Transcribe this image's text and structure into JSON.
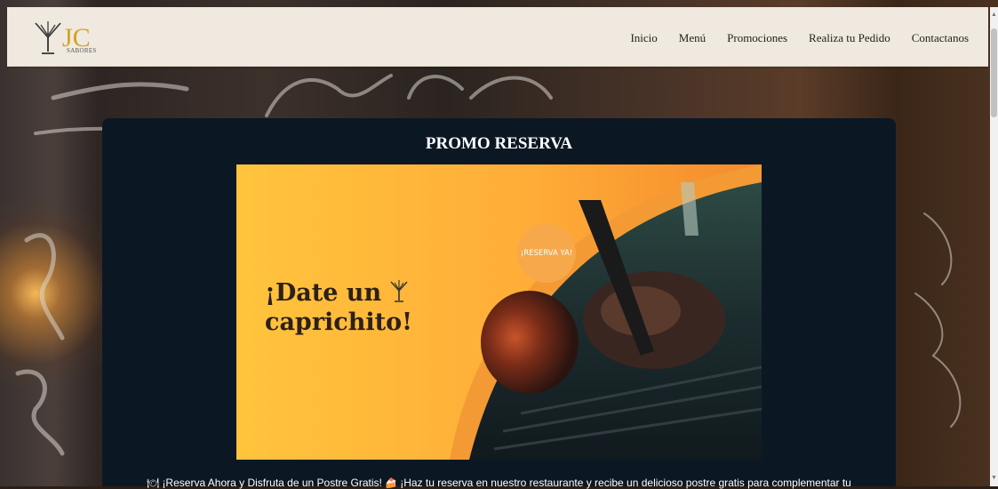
{
  "header": {
    "logo_subtitle": "SABORES",
    "nav": [
      "Inicio",
      "Menú",
      "Promociones",
      "Realiza tu Pedido",
      "Contactanos"
    ]
  },
  "promo": {
    "title": "PROMO RESERVA",
    "headline_line1": "¡Date un",
    "headline_line2": "caprichito!",
    "badge_text": "¡RESERVA YA!",
    "icon_left": "🍽",
    "icon_mid": "🍰",
    "text_part1": "¡Reserva Ahora y Disfruta de un Postre Gratis!",
    "text_part2": "¡Haz tu reserva en nuestro restaurante y recibe un delicioso postre gratis para complementar tu"
  },
  "colors": {
    "topbar_bg": "#efe9df",
    "panel_bg": "#0c1724",
    "banner_yellow": "#ffc13a",
    "banner_orange": "#f58a2c",
    "logo_gold": "#d4a32a"
  },
  "icons": {
    "logo": "cocktail-glass-icon",
    "glass": "cocktail-glass-icon",
    "plate": "plate-icon",
    "cake": "cake-icon"
  }
}
